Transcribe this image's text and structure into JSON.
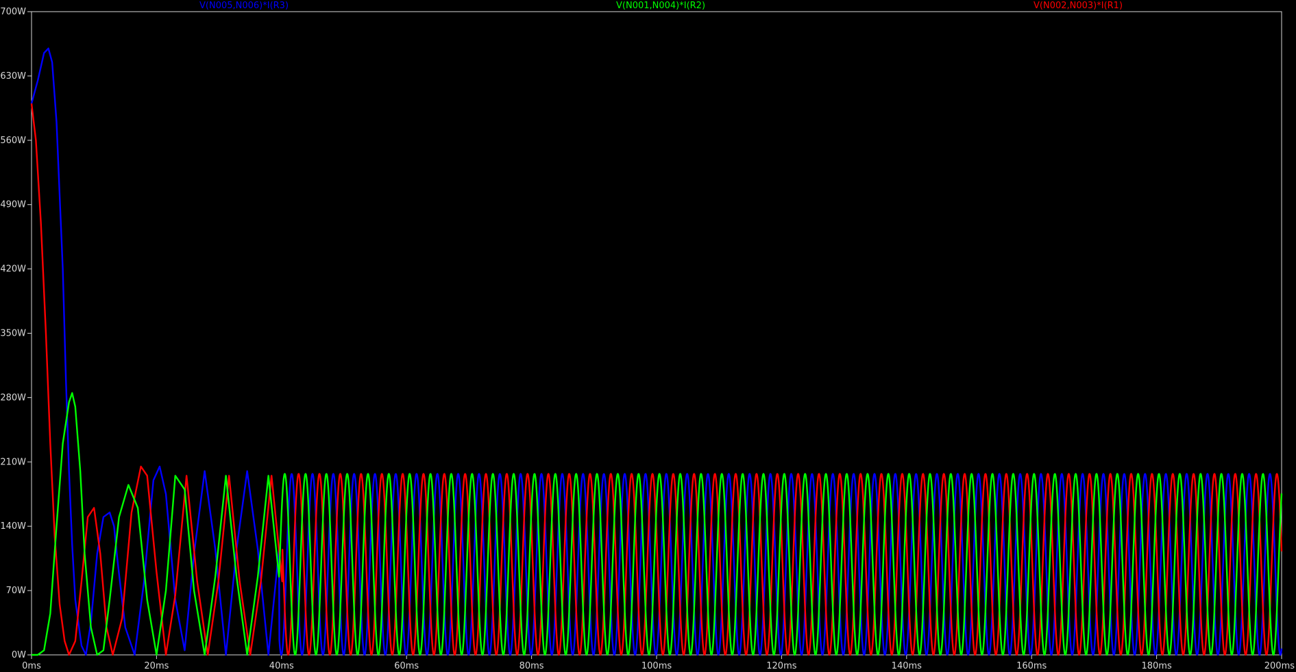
{
  "chart_data": {
    "type": "line",
    "title": "",
    "xlabel": "",
    "ylabel": "",
    "xlim": [
      0,
      200
    ],
    "ylim": [
      0,
      700
    ],
    "x_unit": "ms",
    "y_unit": "W",
    "x_ticks": [
      "0ms",
      "20ms",
      "40ms",
      "60ms",
      "80ms",
      "100ms",
      "120ms",
      "140ms",
      "160ms",
      "180ms",
      "200ms"
    ],
    "y_ticks": [
      "0W",
      "70W",
      "140W",
      "210W",
      "280W",
      "350W",
      "420W",
      "490W",
      "560W",
      "630W",
      "700W"
    ],
    "legend_placement": "top",
    "grid": false,
    "background_color": "#000000",
    "axis_color": "#d8d8d8",
    "series": [
      {
        "name": "V(N005,N006)*I(R3)",
        "color": "#0000ff",
        "x": [
          0,
          1,
          2,
          2.7,
          3.3,
          4,
          5,
          5.5,
          6,
          6.5,
          7,
          8,
          8.7,
          9.5,
          10.5,
          11.5,
          12.5,
          13.2,
          13.8,
          15,
          16.5,
          18,
          19.5,
          20.5,
          21.5,
          23,
          24.5,
          26,
          27.7,
          29.4,
          31.1,
          32.8,
          34.5,
          36.2,
          37.9,
          39.6
        ],
        "y": [
          600,
          625,
          655,
          660,
          645,
          580,
          420,
          300,
          200,
          120,
          60,
          10,
          0,
          35,
          110,
          150,
          155,
          140,
          100,
          30,
          0,
          80,
          190,
          205,
          175,
          60,
          5,
          110,
          200,
          115,
          0,
          115,
          200,
          115,
          0,
          115
        ]
      },
      {
        "name": "V(N001,N004)*I(R2)",
        "color": "#00ff00",
        "x": [
          0,
          1,
          2,
          3,
          4,
          5,
          6,
          6.5,
          7,
          7.8,
          8.5,
          9.5,
          10.5,
          11.5,
          12.5,
          14,
          15.5,
          17,
          18.5,
          20,
          21.5,
          23,
          24.5,
          26,
          27.7,
          29.4,
          31.1,
          32.8,
          34.5,
          36.2,
          37.9,
          39.6
        ],
        "y": [
          0,
          0,
          5,
          45,
          140,
          230,
          275,
          285,
          270,
          200,
          110,
          30,
          0,
          5,
          60,
          150,
          185,
          160,
          60,
          0,
          70,
          195,
          180,
          70,
          0,
          85,
          195,
          85,
          0,
          85,
          195,
          85
        ]
      },
      {
        "name": "V(N002,N003)*I(R1)",
        "color": "#ff0000",
        "x": [
          0,
          0.7,
          1.5,
          2.3,
          3,
          3.7,
          4.5,
          5.3,
          6,
          7,
          8,
          9,
          10,
          11,
          12,
          13,
          14.5,
          16,
          17.5,
          18.5,
          20,
          21.5,
          23,
          24.8,
          26.5,
          28.2,
          29.9,
          31.6,
          33.3,
          35,
          36.7,
          38.4,
          40.1
        ],
        "y": [
          600,
          560,
          470,
          350,
          230,
          130,
          55,
          15,
          0,
          15,
          80,
          150,
          160,
          110,
          30,
          0,
          40,
          155,
          205,
          195,
          90,
          0,
          65,
          195,
          80,
          0,
          80,
          195,
          80,
          0,
          80,
          195,
          80
        ]
      }
    ],
    "steady_state": {
      "start_ms": 40,
      "period_ms": 3.33,
      "max_w": 197,
      "phase_offsets": [
        0,
        0.333,
        0.667
      ]
    }
  }
}
